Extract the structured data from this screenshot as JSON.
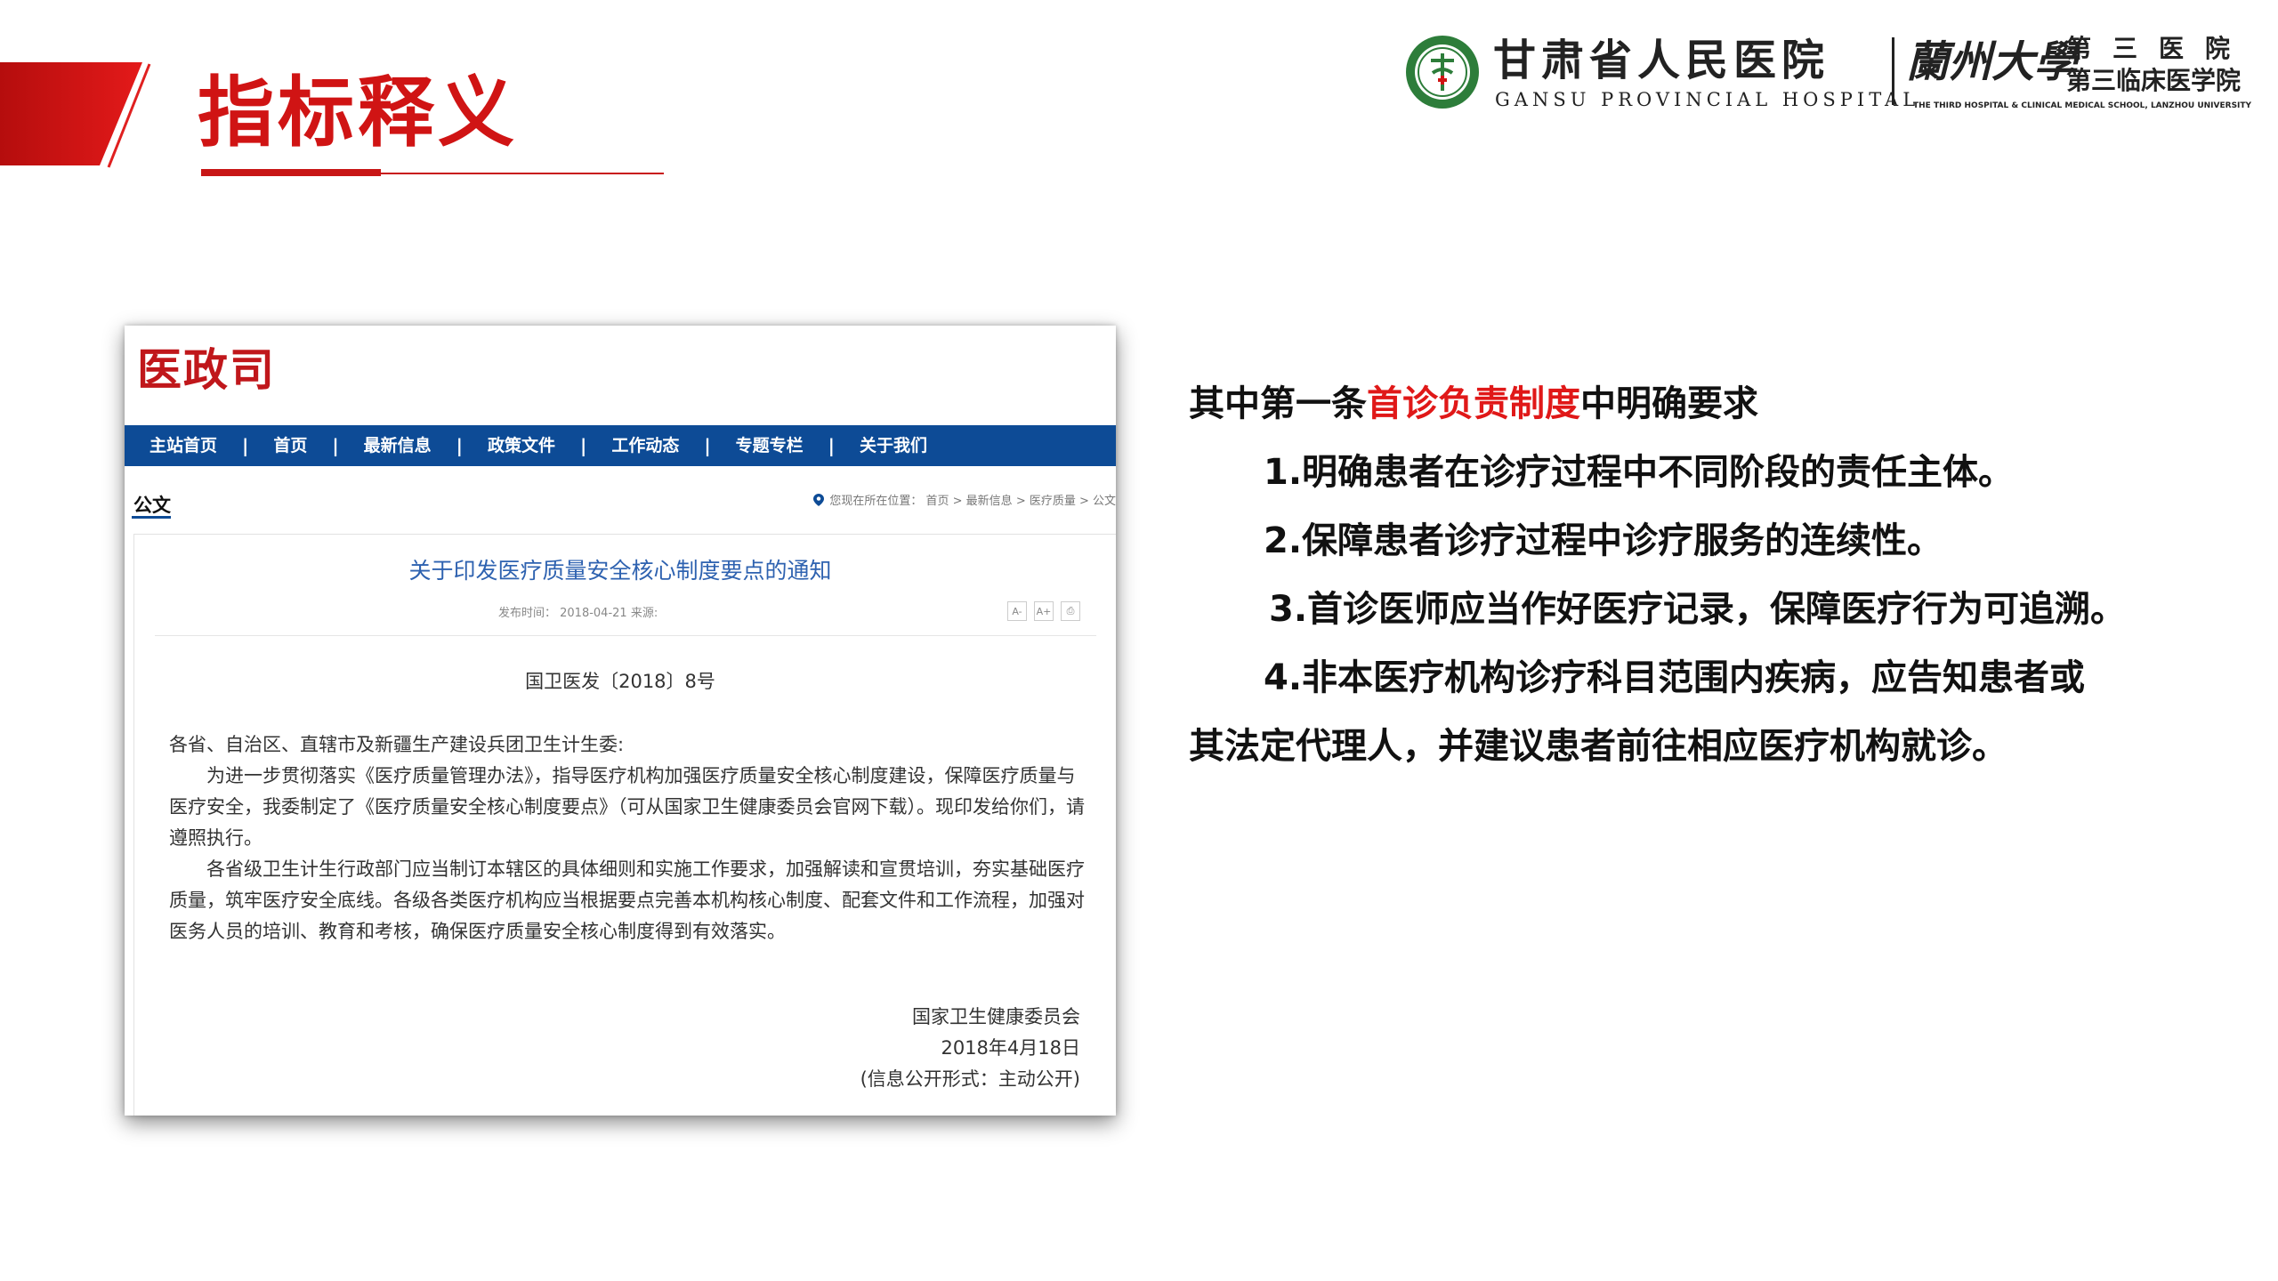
{
  "slide": {
    "title": "指标释义",
    "accent_color": "#d01414"
  },
  "logo": {
    "hospital_cn": "甘肃省人民医院",
    "hospital_en": "GANSU PROVINCIAL HOSPITAL",
    "university_cn": "蘭州大學",
    "university_line1": "第三医院",
    "university_line2": "第三临床医学院",
    "university_en": "THE THIRD HOSPITAL & CLINICAL MEDICAL SCHOOL, LANZHOU UNIVERSITY"
  },
  "document": {
    "site_title": "医政司",
    "nav": [
      "主站首页",
      "首页",
      "最新信息",
      "政策文件",
      "工作动态",
      "专题专栏",
      "关于我们"
    ],
    "nav_separator": "|",
    "section": "公文",
    "breadcrumb": "您现在所在位置： 首页 > 最新信息 > 医疗质量 > 公文",
    "heading": "关于印发医疗质量安全核心制度要点的通知",
    "meta": "发布时间： 2018-04-21    来源:",
    "tools": [
      "A-",
      "A+",
      "⎙"
    ],
    "doc_number": "国卫医发〔2018〕8号",
    "addressee": "各省、自治区、直辖市及新疆生产建设兵团卫生计生委:",
    "paragraph_1": "为进一步贯彻落实《医疗质量管理办法》，指导医疗机构加强医疗质量安全核心制度建设，保障医疗质量与医疗安全，我委制定了《医疗质量安全核心制度要点》（可从国家卫生健康委员会官网下载）。现印发给你们，请遵照执行。",
    "paragraph_2": "各省级卫生计生行政部门应当制订本辖区的具体细则和实施工作要求，加强解读和宣贯培训，夯实基础医疗质量，筑牢医疗安全底线。各级各类医疗机构应当根据要点完善本机构核心制度、配套文件和工作流程，加强对医务人员的培训、教育和考核，确保医疗质量安全核心制度得到有效落实。",
    "signer": "国家卫生健康委员会",
    "date": "2018年4月18日",
    "disclosure": "(信息公开形式：主动公开)"
  },
  "explanation": {
    "intro_pre": "其中第一条",
    "intro_highlight": "首诊负责制度",
    "intro_post": "中明确要求",
    "point_1": "1.明确患者在诊疗过程中不同阶段的责任主体。",
    "point_2": "2.保障患者诊疗过程中诊疗服务的连续性。",
    "point_3": "3.首诊医师应当作好医疗记录，保障医疗行为可追溯。",
    "point_4a": "4.非本医疗机构诊疗科目范围内疾病，应告知患者或",
    "point_4b": "其法定代理人，并建议患者前往相应医疗机构就诊。",
    "highlight_color": "#e01818"
  }
}
